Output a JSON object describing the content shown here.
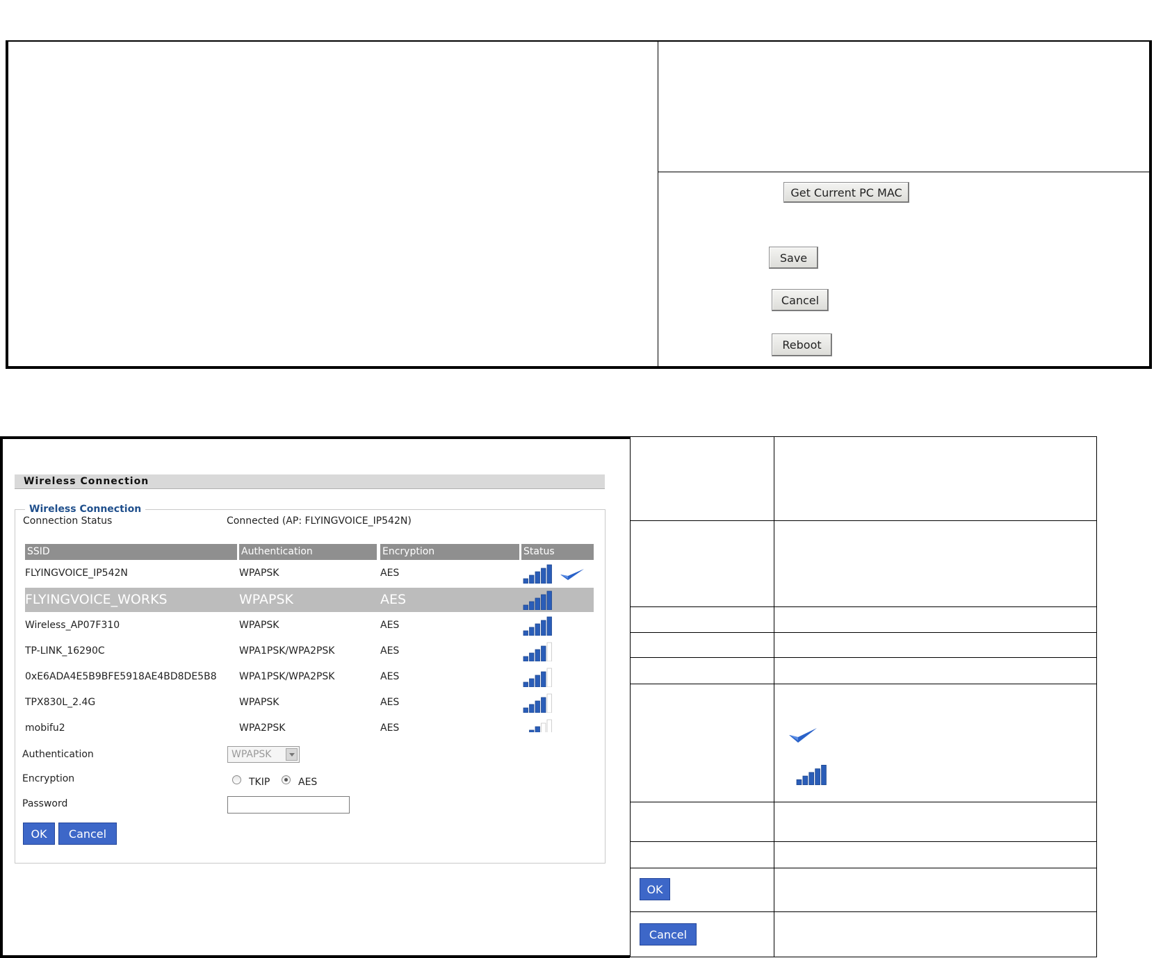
{
  "top_panel": {
    "get_mac_label": "Get Current PC MAC",
    "save_label": "Save",
    "cancel_label": "Cancel",
    "reboot_label": "Reboot"
  },
  "wireless": {
    "section_title": "Wireless Connection",
    "legend": "Wireless Connection",
    "status_label": "Connection Status",
    "status_value": "Connected (AP: FLYINGVOICE_IP542N)",
    "columns": [
      "SSID",
      "Authentication",
      "Encryption",
      "Status"
    ],
    "rows": [
      {
        "ssid": "FLYINGVOICE_IP542N",
        "auth": "WPAPSK",
        "enc": "AES",
        "signal": 5,
        "connected": true
      },
      {
        "ssid": "FLYINGVOICE_WORKS",
        "auth": "WPAPSK",
        "enc": "AES",
        "signal": 5,
        "connected": false,
        "selected": true
      },
      {
        "ssid": "Wireless_AP07F310",
        "auth": "WPAPSK",
        "enc": "AES",
        "signal": 5,
        "connected": false
      },
      {
        "ssid": "TP-LINK_16290C",
        "auth": "WPA1PSK/WPA2PSK",
        "enc": "AES",
        "signal": 4,
        "connected": false
      },
      {
        "ssid": "0xE6ADA4E5B9BFE5918AE4BD8DE5B8",
        "auth": "WPA1PSK/WPA2PSK",
        "enc": "AES",
        "signal": 4,
        "connected": false
      },
      {
        "ssid": "TPX830L_2.4G",
        "auth": "WPAPSK",
        "enc": "AES",
        "signal": 4,
        "connected": false
      },
      {
        "ssid": "mobifu2",
        "auth": "WPA2PSK",
        "enc": "AES",
        "signal": 3,
        "connected": false
      }
    ],
    "auth_label": "Authentication",
    "auth_value": "WPAPSK",
    "enc_label": "Encryption",
    "enc_tkip": "TKIP",
    "enc_aes": "AES",
    "enc_selected": "AES",
    "password_label": "Password",
    "password_value": "",
    "ok_label": "OK",
    "cancel_label": "Cancel"
  },
  "desc_table": {
    "ok_label": "OK",
    "cancel_label": "Cancel"
  },
  "colors": {
    "header_gray": "#8f8f8f",
    "selected_row": "#bcbcbc",
    "signal_blue": "#2a5db8",
    "check_blue": "#2a62c9",
    "button_blue": "#3d67c8"
  }
}
